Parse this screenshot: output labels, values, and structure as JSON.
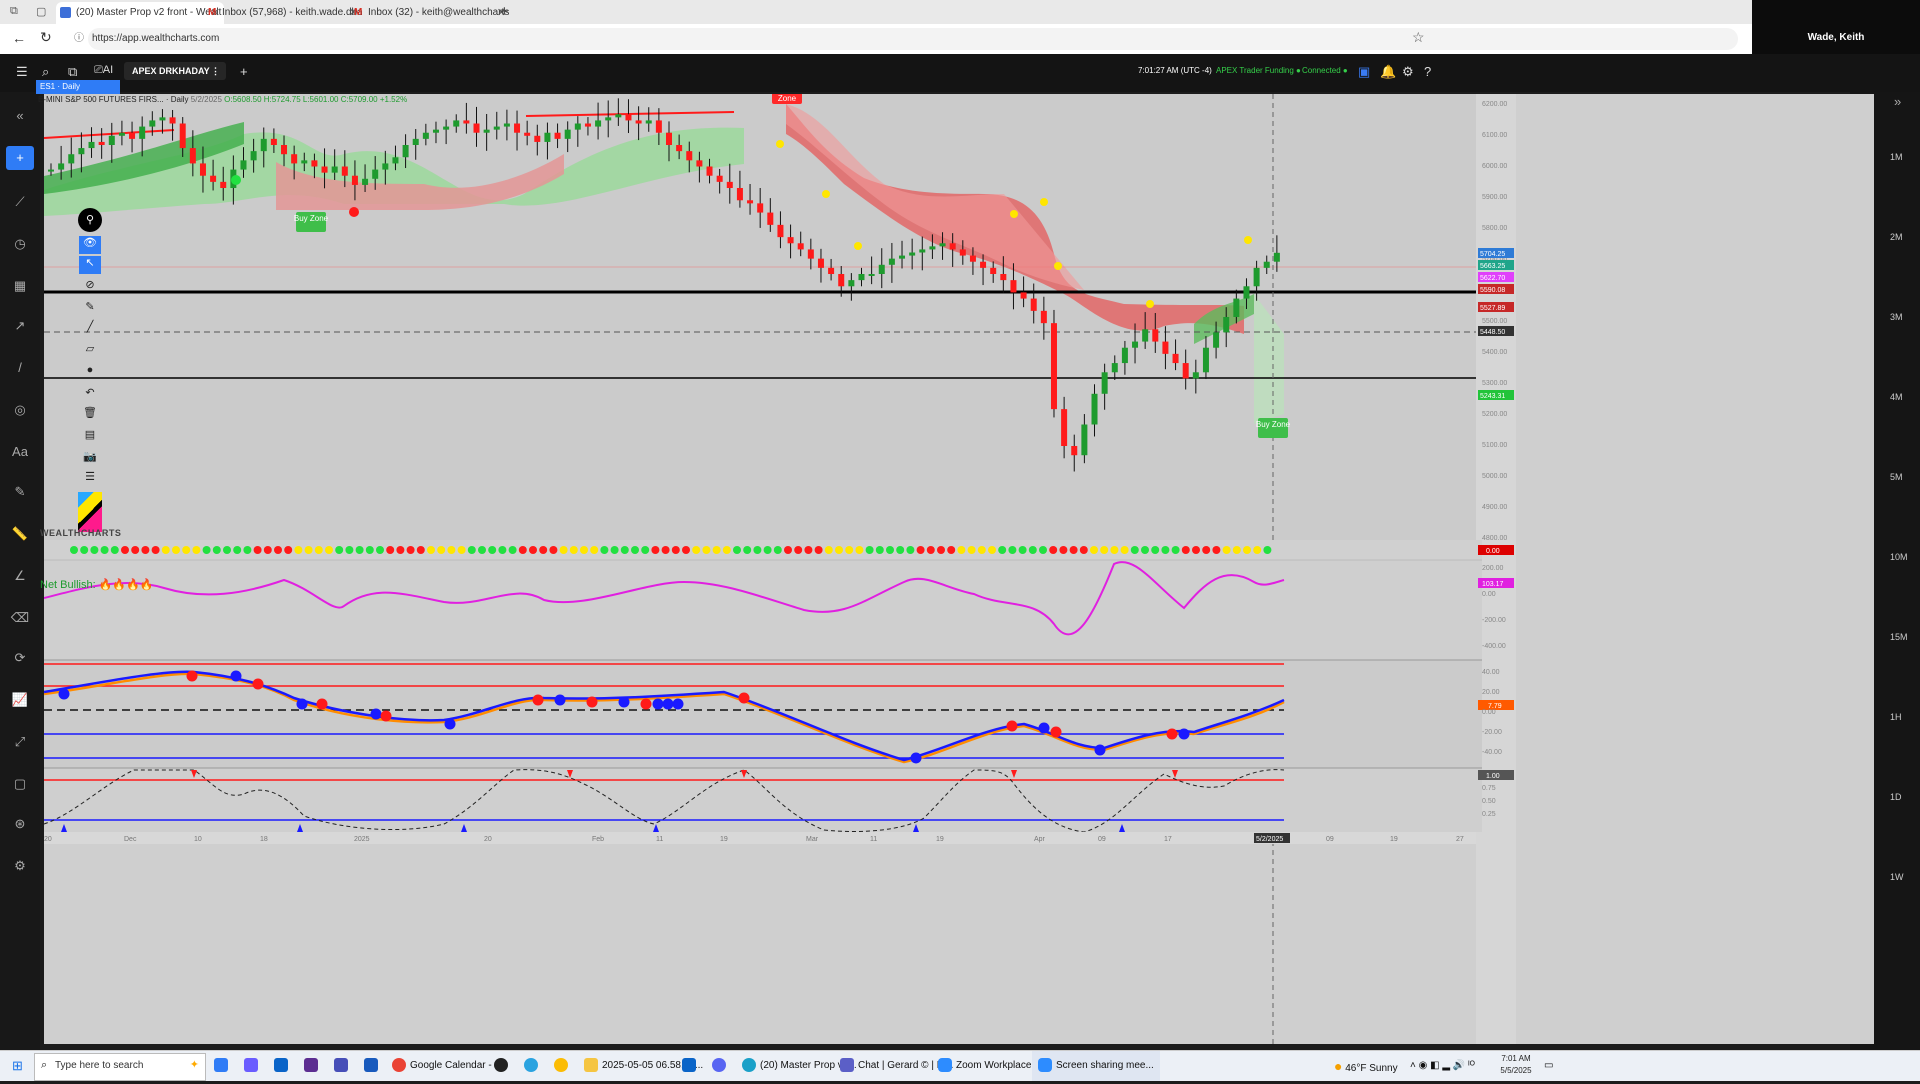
{
  "browser": {
    "tabs": [
      {
        "title": "(20) Master Prop v2 front - Wealt",
        "active": true
      },
      {
        "title": "Inbox (57,968) - keith.wade.dba@",
        "active": false
      },
      {
        "title": "Inbox (32) - keith@wealthcharts.c",
        "active": false
      }
    ],
    "url": "https://app.wealthcharts.com",
    "profile_name": "Wade, Keith"
  },
  "app": {
    "layout_name": "APEX DRKHADAY",
    "clock": "7:01:27 AM",
    "timezone": "(UTC -4)",
    "funding": "APEX Trader Funding",
    "connection": "Connected",
    "chart_tab": "ES1 · Daily",
    "symbol_line": "E-MINI S&P 500 FUTURES FIRS... · Daily",
    "symbol_date": "5/2/2025",
    "ohlc": "O:5608.50 H:5724.75 L:5601.00 C:5709.00 +1.52%",
    "watermark": "WEALTHCHARTS",
    "net_bullish_label": "Net Bullish:",
    "buy_zone_label": "Buy Zone",
    "zone_label": "Zone",
    "crosshair_date": "5/2/2025"
  },
  "price_axis": {
    "ticks": [
      "6200.00",
      "6100.00",
      "6000.00",
      "5900.00",
      "5800.00",
      "5700.00",
      "5600.00",
      "5500.00",
      "5400.00",
      "5300.00",
      "5200.00",
      "5100.00",
      "5000.00",
      "4900.00",
      "4800.00"
    ],
    "tags": [
      {
        "label": "5704.25",
        "color": "#2e7bd6"
      },
      {
        "label": "5663.25",
        "color": "#1fa58a"
      },
      {
        "label": "5622.70",
        "color": "#e040fb"
      },
      {
        "label": "5590.08",
        "color": "#c62828"
      },
      {
        "label": "5527.89",
        "color": "#c62828"
      },
      {
        "label": "5448.50",
        "color": "#333333"
      },
      {
        "label": "5243.31",
        "color": "#22c43a"
      }
    ]
  },
  "panel_tags": {
    "dots": "0.00",
    "osc": "103.17",
    "macd": "7.79",
    "stoch": "1.00"
  },
  "osc_axis": [
    "200.00",
    "0.00",
    "-200.00",
    "-400.00"
  ],
  "macd_axis": [
    "40.00",
    "20.00",
    "0.00",
    "-20.00",
    "-40.00"
  ],
  "stoch_axis": [
    "0.75",
    "0.50",
    "0.25"
  ],
  "time_axis": [
    "20",
    "Dec",
    "10",
    "18",
    "2025",
    "20",
    "Feb",
    "11",
    "19",
    "Mar",
    "11",
    "19",
    "Apr",
    "09",
    "17",
    "5/2/2025",
    "09",
    "19",
    "27"
  ],
  "timeframes": [
    "1M",
    "2M",
    "3M",
    "4M",
    "5M",
    "10M",
    "15M",
    "1H",
    "1D",
    "1W"
  ],
  "taskbar": {
    "search_placeholder": "Type here to search",
    "items": [
      "Google Calendar - ...",
      "2025-05-05 06.58.06...",
      "(20) Master Prop v2...",
      "Chat | Gerard © | M...",
      "Zoom Workplace",
      "Screen sharing mee..."
    ],
    "weather": "46°F  Sunny",
    "time": "7:01 AM",
    "date": "5/5/2025"
  },
  "colors": {
    "up": "#1e9b2e",
    "down": "#ff1a1a",
    "cloud_green": "#7fd17f",
    "cloud_red": "#e77777",
    "osc_line": "#e020e0"
  }
}
